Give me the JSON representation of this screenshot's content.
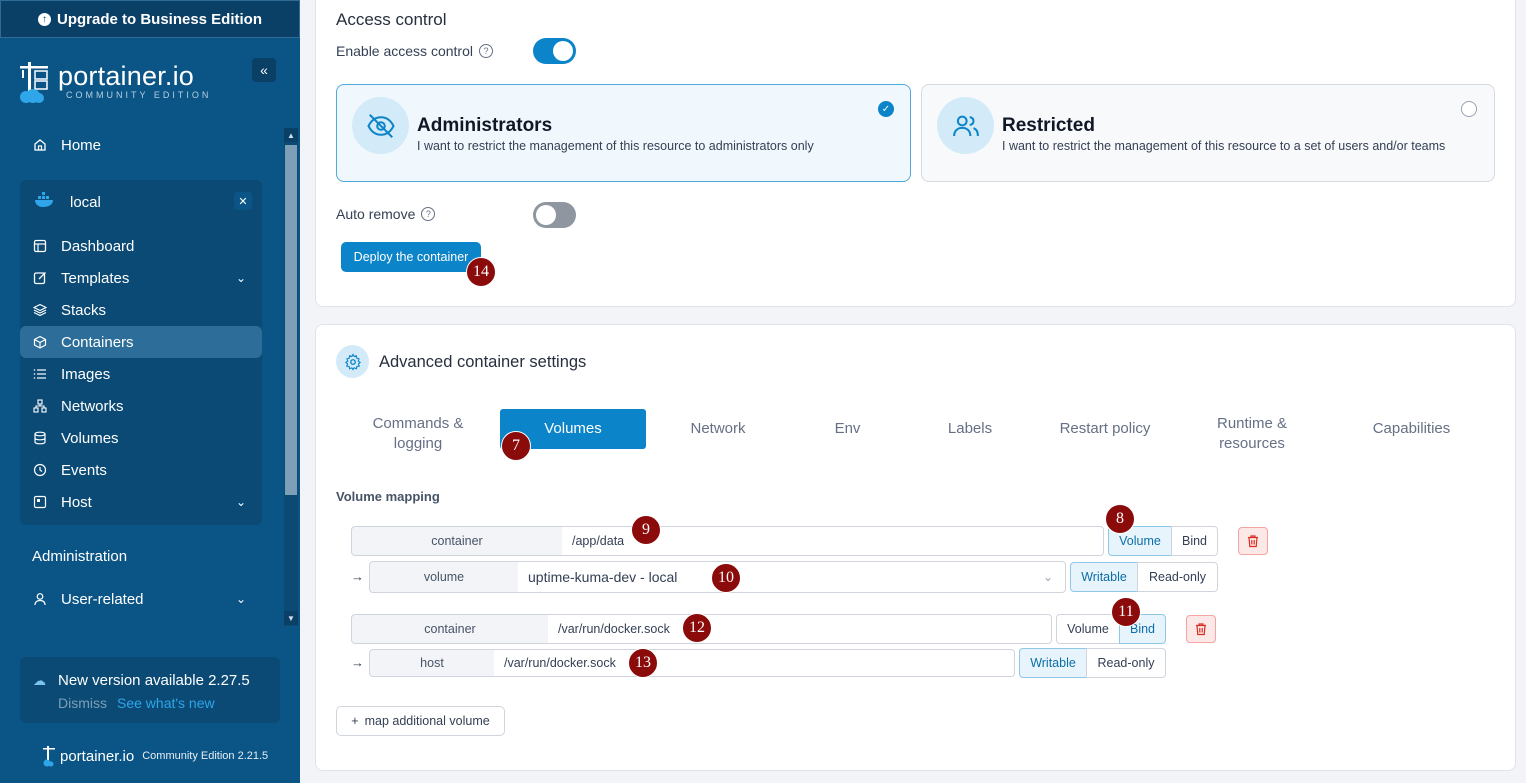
{
  "sidebar": {
    "upgrade_label": "Upgrade to Business Edition",
    "logo_brand": "portainer.io",
    "logo_edition": "COMMUNITY EDITION",
    "home_label": "Home",
    "environment": {
      "name": "local"
    },
    "env_items": [
      {
        "label": "Dashboard"
      },
      {
        "label": "Templates"
      },
      {
        "label": "Stacks"
      },
      {
        "label": "Containers"
      },
      {
        "label": "Images"
      },
      {
        "label": "Networks"
      },
      {
        "label": "Volumes"
      },
      {
        "label": "Events"
      },
      {
        "label": "Host"
      }
    ],
    "administration_title": "Administration",
    "user_related_label": "User-related",
    "update": {
      "title": "New version available 2.27.5",
      "dismiss": "Dismiss",
      "whats_new": "See what's new"
    },
    "footer_brand": "portainer.io",
    "footer_edition": "Community Edition 2.21.5"
  },
  "access_control": {
    "title": "Access control",
    "enable_label": "Enable access control",
    "enabled": true,
    "options": [
      {
        "title": "Administrators",
        "description": "I want to restrict the management of this resource to administrators only",
        "selected": true
      },
      {
        "title": "Restricted",
        "description": "I want to restrict the management of this resource to a set of users and/or teams",
        "selected": false
      }
    ],
    "auto_remove_label": "Auto remove",
    "auto_remove": false,
    "deploy_label": "Deploy the container"
  },
  "advanced": {
    "title": "Advanced container settings",
    "tabs": [
      {
        "line1": "Commands &",
        "line2": "logging"
      },
      {
        "line1": "Volumes",
        "line2": ""
      },
      {
        "line1": "Network",
        "line2": ""
      },
      {
        "line1": "Env",
        "line2": ""
      },
      {
        "line1": "Labels",
        "line2": ""
      },
      {
        "line1": "Restart policy",
        "line2": ""
      },
      {
        "line1": "Runtime &",
        "line2": "resources"
      },
      {
        "line1": "Capabilities",
        "line2": ""
      }
    ],
    "active_tab": "Volumes",
    "volume_mapping_title": "Volume mapping",
    "mappings": [
      {
        "container_label": "container",
        "container_path": "/app/data",
        "type_options": [
          "Volume",
          "Bind"
        ],
        "type_selected": "Volume",
        "source_label": "volume",
        "source_value": "uptime-kuma-dev - local",
        "mode_options": [
          "Writable",
          "Read-only"
        ],
        "mode_selected": "Writable"
      },
      {
        "container_label": "container",
        "container_path": "/var/run/docker.sock",
        "type_options": [
          "Volume",
          "Bind"
        ],
        "type_selected": "Bind",
        "source_label": "host",
        "source_value": "/var/run/docker.sock",
        "mode_options": [
          "Writable",
          "Read-only"
        ],
        "mode_selected": "Writable"
      }
    ],
    "map_additional_label": "map additional volume"
  },
  "annotations": [
    "7",
    "8",
    "9",
    "10",
    "11",
    "12",
    "13",
    "14"
  ],
  "colors": {
    "sidebar": "#0b5586",
    "accent": "#0b84c9",
    "badge": "#8b0a0a"
  },
  "icons": [
    "arrow-up-circle-icon",
    "whale-icon",
    "home-icon",
    "dashboard-icon",
    "templates-icon",
    "stacks-icon",
    "box-icon",
    "list-icon",
    "networks-icon",
    "database-icon",
    "clock-icon",
    "host-icon",
    "user-icon",
    "cloud-download-icon",
    "eye-off-icon",
    "users-icon",
    "gear-icon",
    "trash-icon",
    "plus-icon",
    "arrow-right-icon"
  ]
}
